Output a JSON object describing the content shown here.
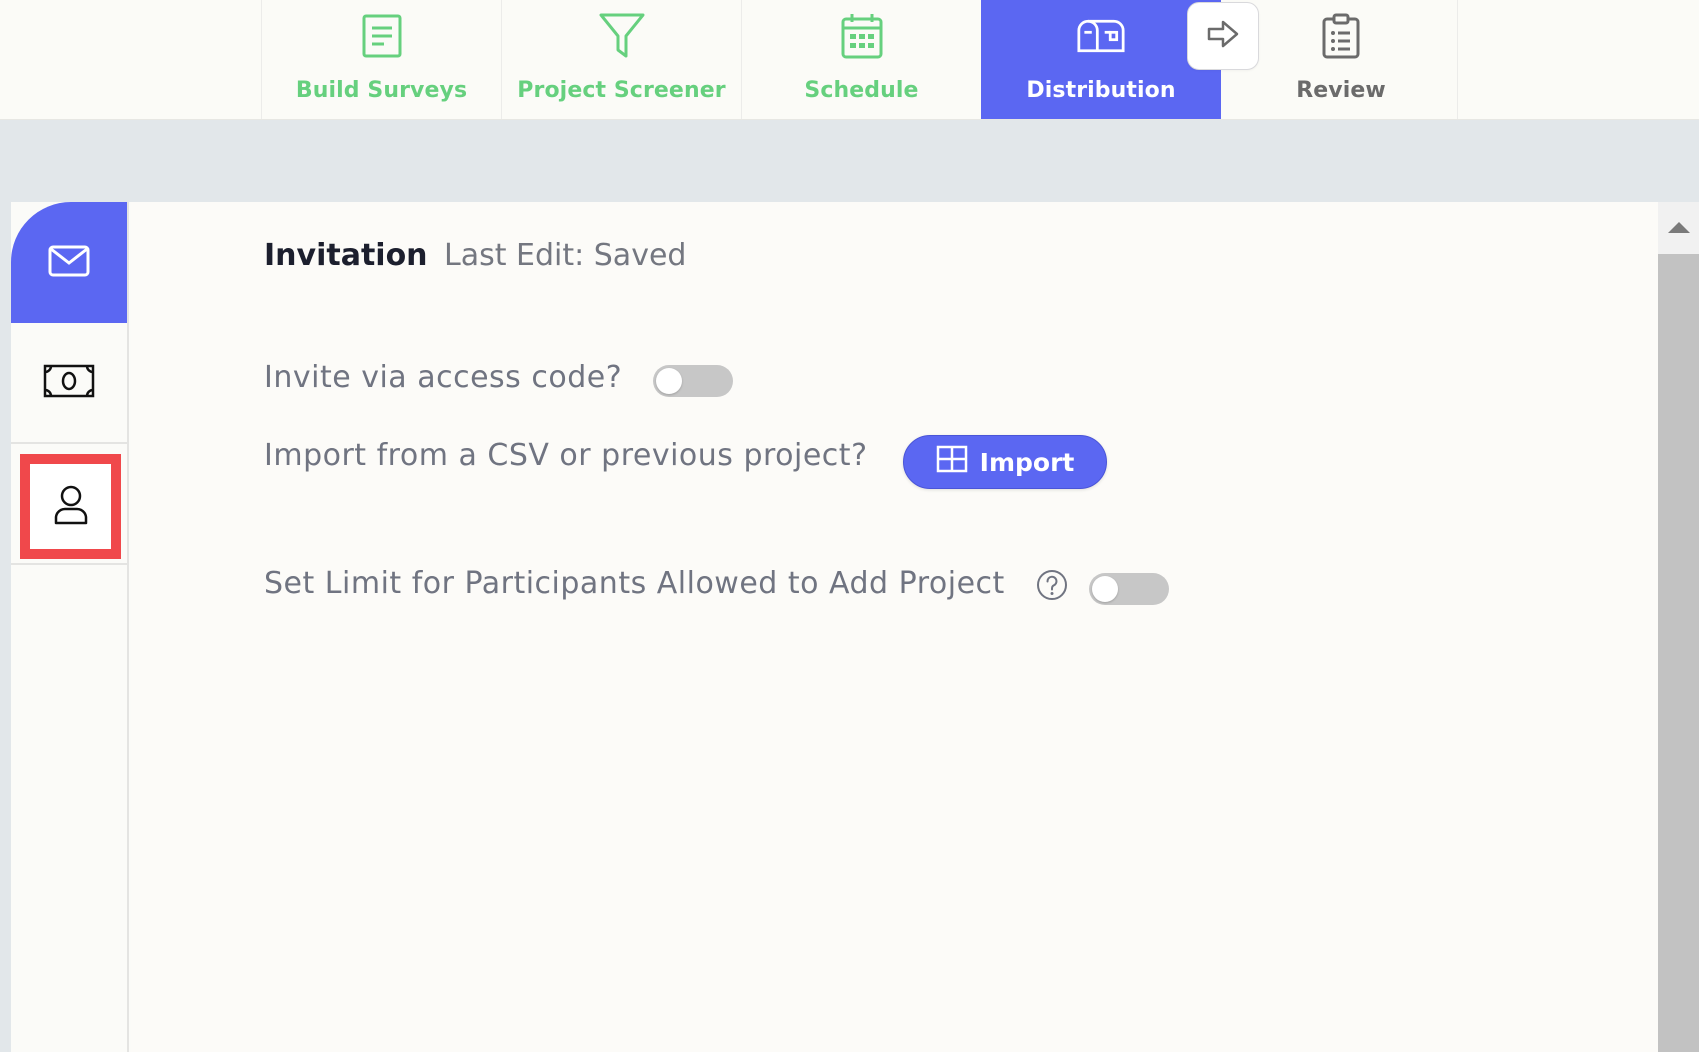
{
  "nav": {
    "tabs": [
      {
        "label": "Build Surveys",
        "icon": "document-icon"
      },
      {
        "label": "Project Screener",
        "icon": "funnel-icon"
      },
      {
        "label": "Schedule",
        "icon": "calendar-icon"
      },
      {
        "label": "Distribution",
        "icon": "mailbox-icon",
        "active": true
      },
      {
        "label": "Review",
        "icon": "clipboard-icon"
      }
    ]
  },
  "side": {
    "items": [
      {
        "icon": "envelope-icon",
        "active": true
      },
      {
        "icon": "cash-icon"
      },
      {
        "icon": "user-icon",
        "highlighted": true
      }
    ]
  },
  "main": {
    "title": "Invitation",
    "status": "Last Edit: Saved",
    "access_code_label": "Invite via access code?",
    "access_code_enabled": false,
    "import_label": "Import from a CSV or previous project?",
    "import_button": "Import",
    "limit_label": "Set Limit for Participants Allowed to Add Project",
    "limit_enabled": false
  },
  "colors": {
    "accent": "#5b67f2",
    "green": "#66d07e",
    "highlight": "#f0484b"
  }
}
